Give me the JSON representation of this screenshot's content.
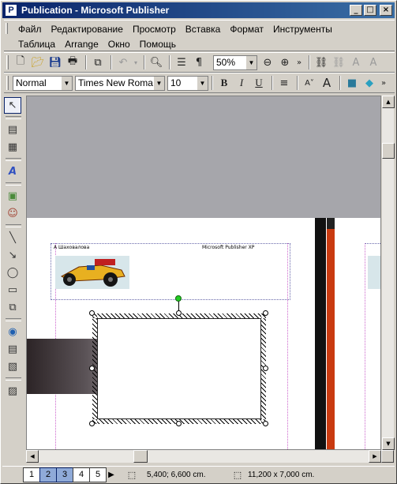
{
  "window": {
    "title": "Publication - Microsoft Publisher",
    "app_icon_glyph": "P",
    "buttons": {
      "minimize": "_",
      "maximize": "□",
      "close": "×"
    }
  },
  "menu": {
    "row1": [
      "Файл",
      "Редактирование",
      "Просмотр",
      "Вставка",
      "Формат",
      "Инструменты"
    ],
    "row2": [
      "Таблица",
      "Arrange",
      "Окно",
      "Помощь"
    ]
  },
  "standard_toolbar": {
    "zoom": "50%",
    "icons": [
      "new-icon",
      "open-icon",
      "save-icon",
      "print-preview-icon",
      "copy-icon",
      "undo-icon",
      "find-icon",
      "columns-icon",
      "pilcrow-icon",
      "zoom-out-icon",
      "zoom-in-icon",
      "more-icon",
      "hyperlink-icon",
      "link-frames-icon",
      "text-effects-icon",
      "text-size-icon"
    ]
  },
  "formatting_toolbar": {
    "style": "Normal",
    "font": "Times New Roman",
    "size": "10",
    "bold": "B",
    "italic": "I",
    "underline": "U"
  },
  "page": {
    "header_left": "А Шаховалова",
    "header_right": "Microsoft Publisher XP"
  },
  "statusbar": {
    "pages": [
      "1",
      "2",
      "3",
      "4",
      "5"
    ],
    "active_pages": [
      "2",
      "3"
    ],
    "position": "5,400; 6,600 cm.",
    "size": "11,200 x   7,000 cm."
  },
  "colors": {
    "titlebar_start": "#0a246a",
    "titlebar_end": "#3a6ea5",
    "workspace": "#a6a6ab",
    "accent_orange": "#c93a10"
  }
}
